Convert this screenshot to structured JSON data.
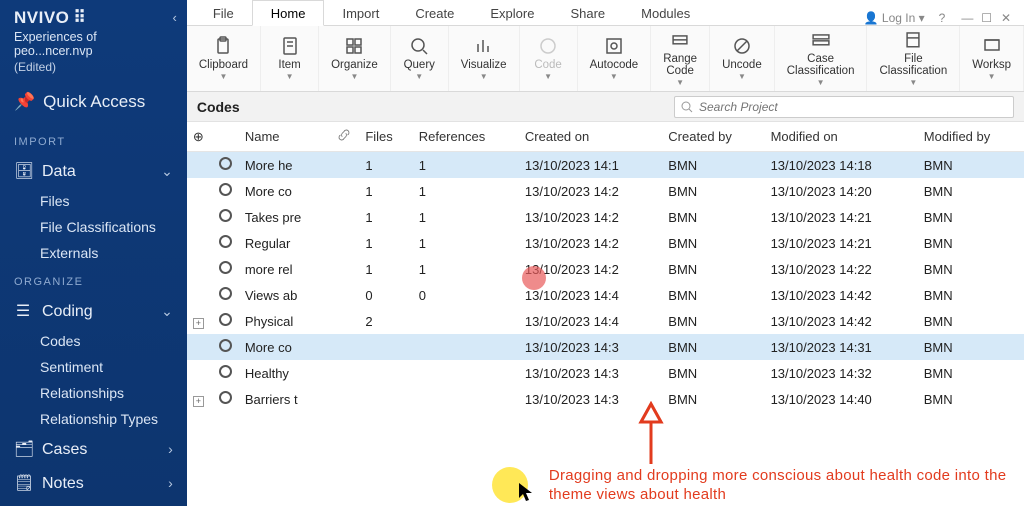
{
  "brand": "NVIVO",
  "project_file": "Experiences of peo...ncer.nvp",
  "project_status": "(Edited)",
  "quick_access": "Quick Access",
  "nav": {
    "import_hdr": "IMPORT",
    "data": "Data",
    "data_children": [
      "Files",
      "File Classifications",
      "Externals"
    ],
    "organize_hdr": "ORGANIZE",
    "coding": "Coding",
    "coding_children": [
      "Codes",
      "Sentiment",
      "Relationships",
      "Relationship Types"
    ],
    "cases": "Cases",
    "notes": "Notes"
  },
  "tabs": [
    "File",
    "Home",
    "Import",
    "Create",
    "Explore",
    "Share",
    "Modules"
  ],
  "active_tab": "Home",
  "login": "Log In",
  "ribbon": [
    {
      "k": "clipboard",
      "label": "Clipboard"
    },
    {
      "k": "item",
      "label": "Item"
    },
    {
      "k": "organize",
      "label": "Organize"
    },
    {
      "k": "query",
      "label": "Query"
    },
    {
      "k": "visualize",
      "label": "Visualize"
    },
    {
      "k": "code",
      "label": "Code",
      "disabled": true
    },
    {
      "k": "autocode",
      "label": "Autocode"
    },
    {
      "k": "rangecode",
      "label": "Range\nCode"
    },
    {
      "k": "uncode",
      "label": "Uncode"
    },
    {
      "k": "caseclass",
      "label": "Case\nClassification"
    },
    {
      "k": "fileclass",
      "label": "File\nClassification"
    },
    {
      "k": "workspace",
      "label": "Worksp"
    }
  ],
  "pane_title": "Codes",
  "search_placeholder": "Search Project",
  "columns": [
    "Name",
    "Files",
    "References",
    "Created on",
    "Created by",
    "Modified on",
    "Modified by"
  ],
  "rows": [
    {
      "name": "More he",
      "files": "1",
      "refs": "1",
      "con": "13/10/2023 14:1",
      "cby": "BMN",
      "mon": "13/10/2023 14:18",
      "mby": "BMN",
      "sel": true
    },
    {
      "name": "More co",
      "files": "1",
      "refs": "1",
      "con": "13/10/2023 14:2",
      "cby": "BMN",
      "mon": "13/10/2023 14:20",
      "mby": "BMN"
    },
    {
      "name": "Takes pre",
      "files": "1",
      "refs": "1",
      "con": "13/10/2023 14:2",
      "cby": "BMN",
      "mon": "13/10/2023 14:21",
      "mby": "BMN"
    },
    {
      "name": "Regular",
      "files": "1",
      "refs": "1",
      "con": "13/10/2023 14:2",
      "cby": "BMN",
      "mon": "13/10/2023 14:21",
      "mby": "BMN"
    },
    {
      "name": "more rel",
      "files": "1",
      "refs": "1",
      "con": "13/10/2023 14:2",
      "cby": "BMN",
      "mon": "13/10/2023 14:22",
      "mby": "BMN"
    },
    {
      "name": "Views ab",
      "files": "0",
      "refs": "0",
      "con": "13/10/2023 14:4",
      "cby": "BMN",
      "mon": "13/10/2023 14:42",
      "mby": "BMN"
    },
    {
      "name": "Physical",
      "files": "2",
      "refs": "",
      "con": "13/10/2023 14:4",
      "cby": "BMN",
      "mon": "13/10/2023 14:42",
      "mby": "BMN",
      "exp": true
    },
    {
      "name": "More co",
      "files": "",
      "refs": "",
      "con": "13/10/2023 14:3",
      "cby": "BMN",
      "mon": "13/10/2023 14:31",
      "mby": "BMN",
      "drag": true
    },
    {
      "name": "Healthy",
      "files": "",
      "refs": "",
      "con": "13/10/2023 14:3",
      "cby": "BMN",
      "mon": "13/10/2023 14:32",
      "mby": "BMN"
    },
    {
      "name": "Barriers t",
      "files": "",
      "refs": "",
      "con": "13/10/2023 14:3",
      "cby": "BMN",
      "mon": "13/10/2023 14:40",
      "mby": "BMN",
      "exp": true
    }
  ],
  "annotation": "Dragging and dropping more conscious about health code into the theme views about health"
}
